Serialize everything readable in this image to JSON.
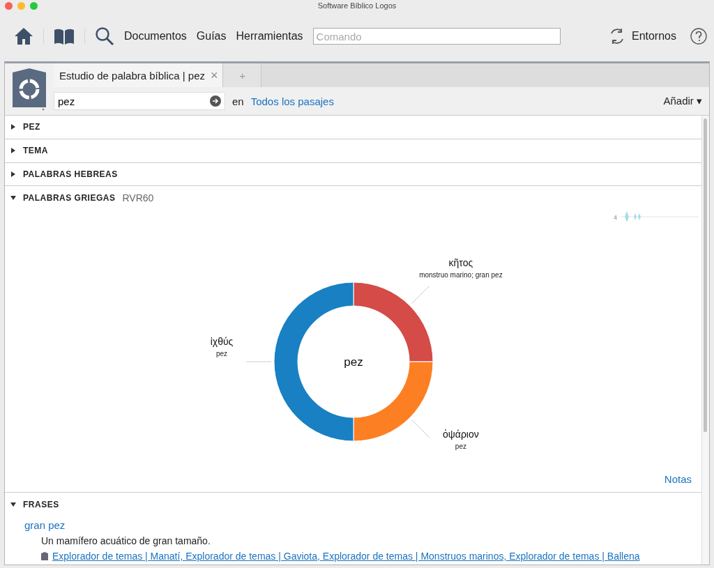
{
  "window": {
    "title": "Software Bíblico Logos"
  },
  "toolbar": {
    "nav": [
      "Documentos",
      "Guías",
      "Herramientas"
    ],
    "command_placeholder": "Comando",
    "environments": "Entornos"
  },
  "tabs": [
    {
      "label": "Estudio de palabra bíblica | pez",
      "selected": true,
      "close": "×"
    },
    {
      "label": "+",
      "selected": false
    }
  ],
  "search": {
    "value": "pez",
    "in_label": "en",
    "scope": "Todos los pasajes",
    "add": "Añadir",
    "add_caret": "▾"
  },
  "sections": [
    {
      "title": "PEZ",
      "expanded": false
    },
    {
      "title": "TEMA",
      "expanded": false
    },
    {
      "title": "PALABRAS HEBREAS",
      "expanded": false
    }
  ],
  "greek": {
    "title": "PALABRAS GRIEGAS",
    "tag": "RVR60",
    "expanded": true,
    "sparkline_count": "4",
    "glosses": [
      "monstruo marino; gran pez",
      "pez",
      "pez"
    ],
    "chart_data": {
      "type": "donut",
      "categories": [
        "κῆτος",
        "ὀψάριον",
        "ἰχθύς"
      ],
      "series": [
        {
          "name": "pez",
          "values": [
            25,
            25,
            50
          ]
        }
      ],
      "colors": [
        "#d44b47",
        "#fd7f23",
        "#1980c3"
      ]
    },
    "notes": "Notas"
  },
  "phrases": {
    "title": "FRASES",
    "expanded": true,
    "items": [
      {
        "phrase": "gran pez",
        "description": "Un mamífero acuático de gran tamaño.",
        "links": "Explorador de temas | Manatí, Explorador de temas | Gaviota, Explorador de temas | Monstruos marinos, Explorador de temas | Ballena"
      }
    ]
  }
}
